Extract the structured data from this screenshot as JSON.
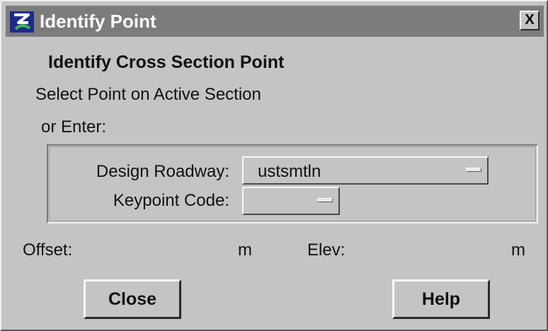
{
  "window": {
    "title": "Identify Point",
    "close_glyph": "X",
    "icon": "app-logo-icon"
  },
  "dialog": {
    "heading": "Identify Cross Section Point",
    "instruction_line1": "Select Point on Active Section",
    "instruction_line2": "or Enter:"
  },
  "fields": {
    "design_roadway_label": "Design Roadway:",
    "design_roadway_value": "ustsmtln",
    "keypoint_code_label": "Keypoint Code:",
    "keypoint_code_value": ""
  },
  "readout": {
    "offset_label": "Offset:",
    "offset_unit": "m",
    "elev_label": "Elev:",
    "elev_unit": "m"
  },
  "buttons": {
    "close_label": "Close",
    "help_label": "Help"
  },
  "colors": {
    "title_bar": "#7c7c7c",
    "dialog_bg": "#c4c4c4",
    "title_text": "#ffffff"
  }
}
